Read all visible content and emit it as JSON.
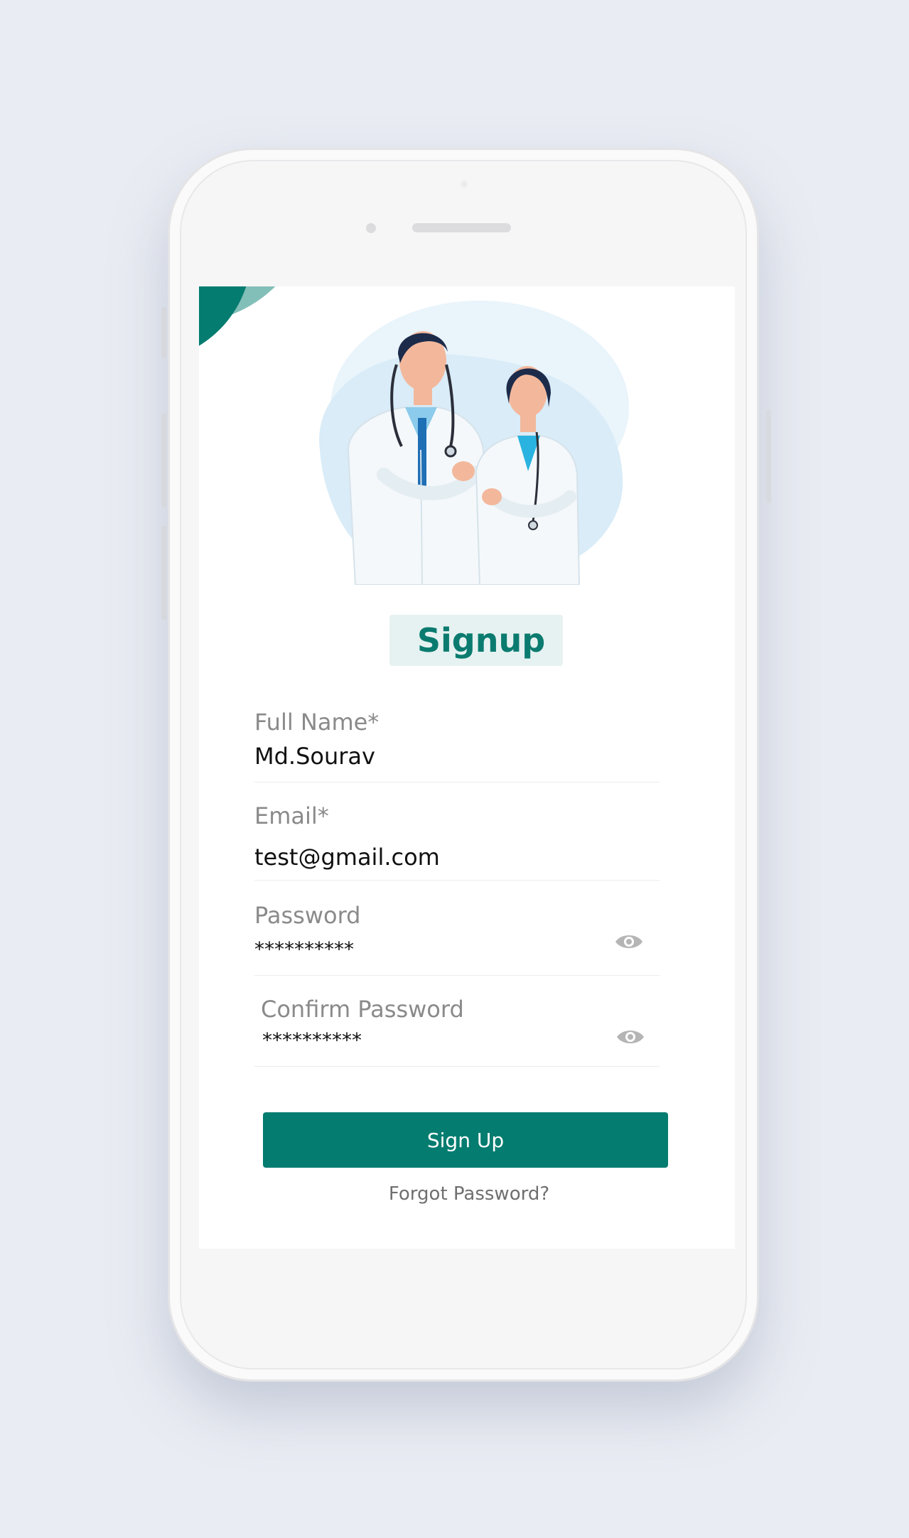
{
  "signup": {
    "title": "Signup",
    "full_name_label": "Full Name*",
    "full_name_value": "Md.Sourav",
    "email_label": "Email*",
    "email_value": "test@gmail.com",
    "password_label": "Password",
    "password_value": "**********",
    "confirm_password_label": "Confirm Password",
    "confirm_password_value": "**********",
    "submit_label": "Sign Up",
    "forgot_label": "Forgot Password?"
  },
  "icons": {
    "password_toggle": "eye-icon",
    "confirm_password_toggle": "eye-icon"
  },
  "colors": {
    "accent": "#047c70",
    "accent_light": "#82bfb8",
    "title_bg": "#e6f2f1",
    "background": "#e9ecf3"
  }
}
